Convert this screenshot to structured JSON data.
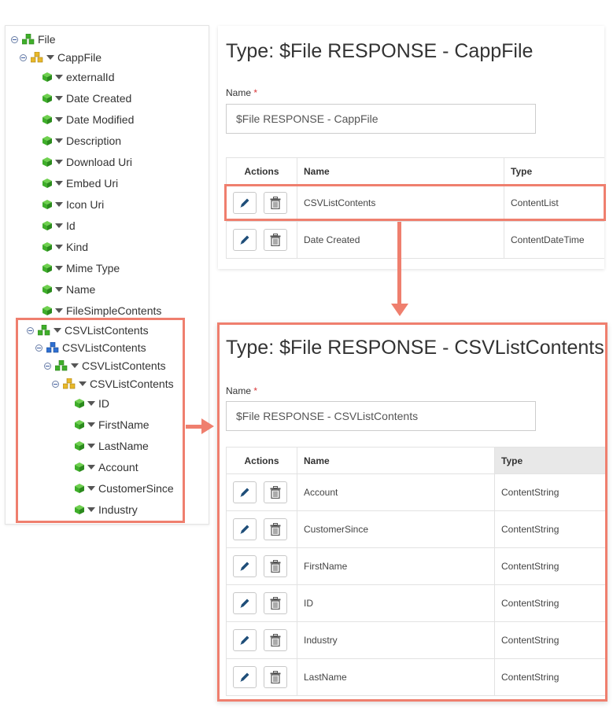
{
  "tree": {
    "root": "File",
    "cappfile": "CappFile",
    "cappfile_children": [
      "externalId",
      "Date Created",
      "Date Modified",
      "Description",
      "Download Uri",
      "Embed Uri",
      "Icon Uri",
      "Id",
      "Kind",
      "Mime Type",
      "Name",
      "FileSimpleContents"
    ],
    "csv_list": "CSVListContents",
    "csv_list_child": "CSVListContents",
    "csv_list_grandchild": "CSVListContents",
    "csv_list_leaf": "CSVListContents",
    "csv_leaf_children": [
      "ID",
      "FirstName",
      "LastName",
      "Account",
      "CustomerSince",
      "Industry"
    ]
  },
  "top_card": {
    "title": "Type: $File RESPONSE - CappFile",
    "name_label": "Name",
    "required_mark": "*",
    "name_value": "$File RESPONSE - CappFile",
    "columns": [
      "Actions",
      "Name",
      "Type"
    ],
    "rows": [
      {
        "name": "CSVListContents",
        "type": "ContentList"
      },
      {
        "name": "Date Created",
        "type": "ContentDateTime"
      }
    ]
  },
  "bottom_card": {
    "title": "Type: $File RESPONSE - CSVListContents",
    "name_label": "Name",
    "required_mark": "*",
    "name_value": "$File RESPONSE - CSVListContents",
    "columns": [
      "Actions",
      "Name",
      "Type"
    ],
    "rows": [
      {
        "name": "Account",
        "type": "ContentString"
      },
      {
        "name": "CustomerSince",
        "type": "ContentString"
      },
      {
        "name": "FirstName",
        "type": "ContentString"
      },
      {
        "name": "ID",
        "type": "ContentString"
      },
      {
        "name": "Industry",
        "type": "ContentString"
      },
      {
        "name": "LastName",
        "type": "ContentString"
      }
    ]
  },
  "icons": {
    "edit": "pencil-icon",
    "delete": "trash-icon",
    "tree_green": "green-cube-icon",
    "tree_cluster": "cube-cluster-icon"
  },
  "colors": {
    "highlight": "#ef7f6e",
    "cube_green": "#3fae2a",
    "cluster_yellow": "#e8b82a",
    "cluster_blue": "#2f6fd1",
    "edit_icon": "#1f4e79"
  }
}
